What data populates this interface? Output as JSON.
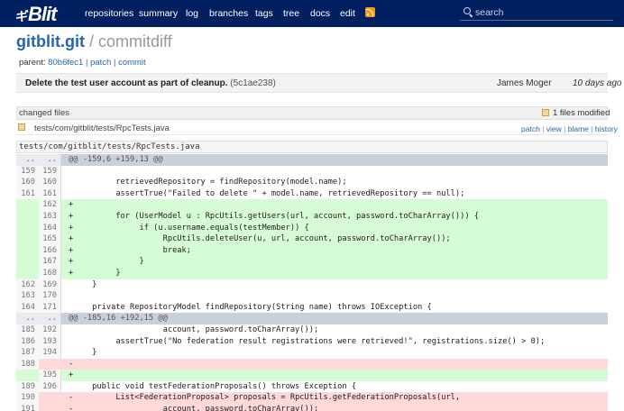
{
  "brand": {
    "mark": "ギ",
    "word": "Blit"
  },
  "nav": [
    {
      "label": "repositories",
      "key": "repositories"
    },
    {
      "label": "summary",
      "key": "summary"
    },
    {
      "label": "log",
      "key": "log"
    },
    {
      "label": "branches",
      "key": "branches"
    },
    {
      "label": "tags",
      "key": "tags"
    },
    {
      "label": "tree",
      "key": "tree"
    },
    {
      "label": "docs",
      "key": "docs"
    },
    {
      "label": "edit",
      "key": "edit"
    }
  ],
  "search": {
    "placeholder": "search",
    "icon": "search-icon"
  },
  "repo": {
    "name": "gitblit.git",
    "separator": "/",
    "page": "commitdiff"
  },
  "parent": {
    "label": "parent:",
    "sha": "80b6fec1",
    "patch": "patch",
    "commit": "commit"
  },
  "commit": {
    "message": "Delete the test user account as part of cleanup.",
    "sha": "(5c1ae238)",
    "author": "James Moger",
    "date": "10 days ago"
  },
  "changed_files": {
    "label": "changed files",
    "modified": "1 files modified",
    "files": [
      {
        "path": "tests/com/gitblit/tests/RpcTests.java",
        "links": [
          "patch",
          "view",
          "blame",
          "history"
        ]
      }
    ]
  },
  "diff": {
    "file": "tests/com/gitblit/tests/RpcTests.java",
    "lines": [
      {
        "t": "hunk",
        "o": "..",
        "n": "..",
        "c": "@@ -159,6 +159,13 @@"
      },
      {
        "t": "ctx",
        "o": "159",
        "n": "159",
        "c": ""
      },
      {
        "t": "ctx",
        "o": "160",
        "n": "160",
        "c": "\t\tretrievedRepository = findRepository(model.name);"
      },
      {
        "t": "ctx",
        "o": "161",
        "n": "161",
        "c": "\t\tassertTrue(\"Failed to delete \" + model.name, retrievedRepository == null);"
      },
      {
        "t": "add",
        "o": "",
        "n": "162",
        "c": "+"
      },
      {
        "t": "add",
        "o": "",
        "n": "163",
        "c": "+\t\tfor (UserModel u : RpcUtils.getUsers(url, account, password.toCharArray())) {"
      },
      {
        "t": "add",
        "o": "",
        "n": "164",
        "c": "+\t\t\tif (u.username.equals(testMember)) {"
      },
      {
        "t": "add",
        "o": "",
        "n": "165",
        "c": "+\t\t\t\tRpcUtils.deleteUser(u, url, account, password.toCharArray());"
      },
      {
        "t": "add",
        "o": "",
        "n": "166",
        "c": "+\t\t\t\tbreak;"
      },
      {
        "t": "add",
        "o": "",
        "n": "167",
        "c": "+\t\t\t}"
      },
      {
        "t": "add",
        "o": "",
        "n": "168",
        "c": "+\t\t}"
      },
      {
        "t": "ctx",
        "o": "162",
        "n": "169",
        "c": "\t}"
      },
      {
        "t": "ctx",
        "o": "163",
        "n": "170",
        "c": ""
      },
      {
        "t": "ctx",
        "o": "164",
        "n": "171",
        "c": "\tprivate RepositoryModel findRepository(String name) throws IOException {"
      },
      {
        "t": "hunk",
        "o": "..",
        "n": "..",
        "c": "@@ -185,16 +192,15 @@"
      },
      {
        "t": "ctx",
        "o": "185",
        "n": "192",
        "c": "\t\t\t\taccount, password.toCharArray());"
      },
      {
        "t": "ctx",
        "o": "186",
        "n": "193",
        "c": "\t\tassertTrue(\"No federation result registrations were retrieved!\", registrations.size() > 0);"
      },
      {
        "t": "ctx",
        "o": "187",
        "n": "194",
        "c": "\t}"
      },
      {
        "t": "del",
        "o": "188",
        "n": "",
        "c": "-"
      },
      {
        "t": "add",
        "o": "",
        "n": "195",
        "c": "+"
      },
      {
        "t": "ctx",
        "o": "189",
        "n": "196",
        "c": "\tpublic void testFederationProposals() throws Exception {"
      },
      {
        "t": "del",
        "o": "190",
        "n": "",
        "c": "-\t\tList<FederationProposal> proposals = RpcUtils.getFederationProposals(url,"
      },
      {
        "t": "del",
        "o": "191",
        "n": "",
        "c": "-\t\t\t\taccount, password.toCharArray());"
      }
    ]
  },
  "colors": {
    "topbar": "#002060",
    "link": "#2466b1",
    "added": "#d6fcd6",
    "deleted": "#ffd9d9",
    "hunk": "#c9d0d8"
  }
}
